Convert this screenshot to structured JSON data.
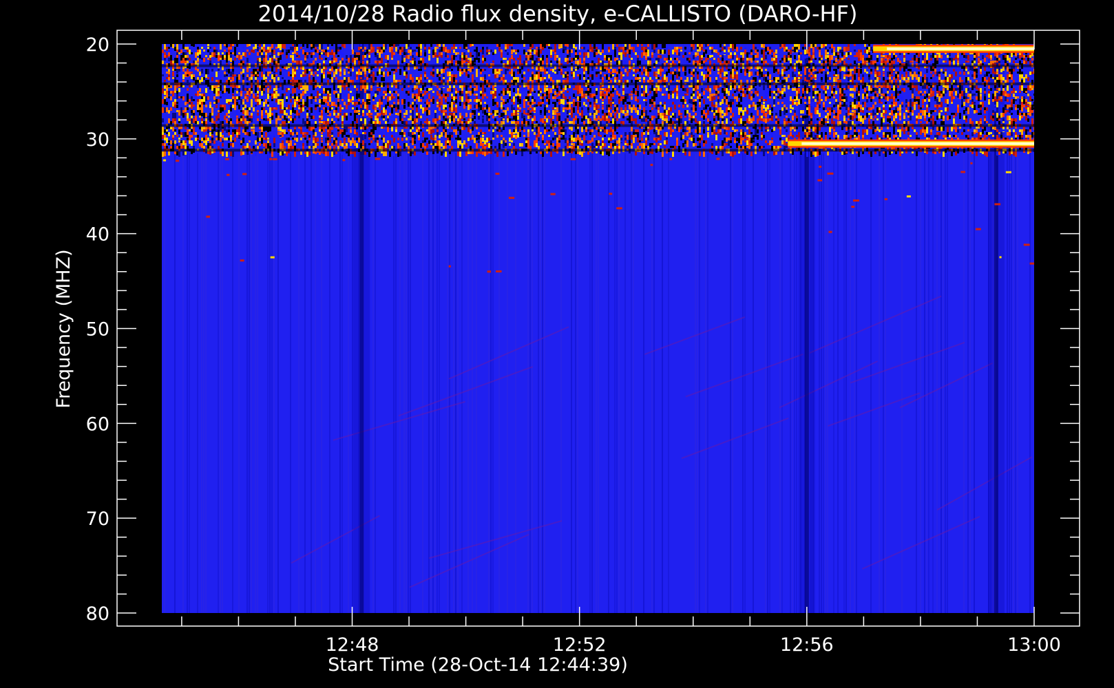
{
  "chart_data": {
    "type": "heatmap",
    "title": "2014/10/28  Radio flux density, e-CALLISTO (DARO-HF)",
    "xlabel": "Start Time (28-Oct-14 12:44:39)",
    "ylabel": "Frequency (MHZ)",
    "x_tick_labels": [
      "12:48",
      "12:52",
      "12:56",
      "13:00"
    ],
    "y_tick_labels": [
      "20",
      "30",
      "40",
      "50",
      "60",
      "70",
      "80"
    ],
    "x_range": [
      "12:44:39",
      "13:00:00"
    ],
    "ylim": [
      20,
      80
    ],
    "y_inverted": true,
    "colormap": [
      "#000000",
      "#1a1aff",
      "#c01010",
      "#ff3b00",
      "#ffd800",
      "#ffffcc"
    ],
    "background_color": "#2020f0",
    "features": [
      {
        "type": "noise band",
        "freq_range_mhz": [
          20,
          31.5
        ],
        "time_range": [
          "12:44:39",
          "13:00:00"
        ]
      },
      {
        "type": "bright band",
        "freq_mhz": 20.5,
        "time_range": [
          "12:57:10",
          "13:00:00"
        ]
      },
      {
        "type": "bright band",
        "freq_mhz": 30.5,
        "time_range": [
          "12:55:40",
          "13:00:00"
        ]
      },
      {
        "type": "dark vertical stripe",
        "time": "12:48:10"
      },
      {
        "type": "dark vertical stripe",
        "time": "12:56:00"
      },
      {
        "type": "dark vertical stripe",
        "time": "12:59:20"
      }
    ]
  }
}
